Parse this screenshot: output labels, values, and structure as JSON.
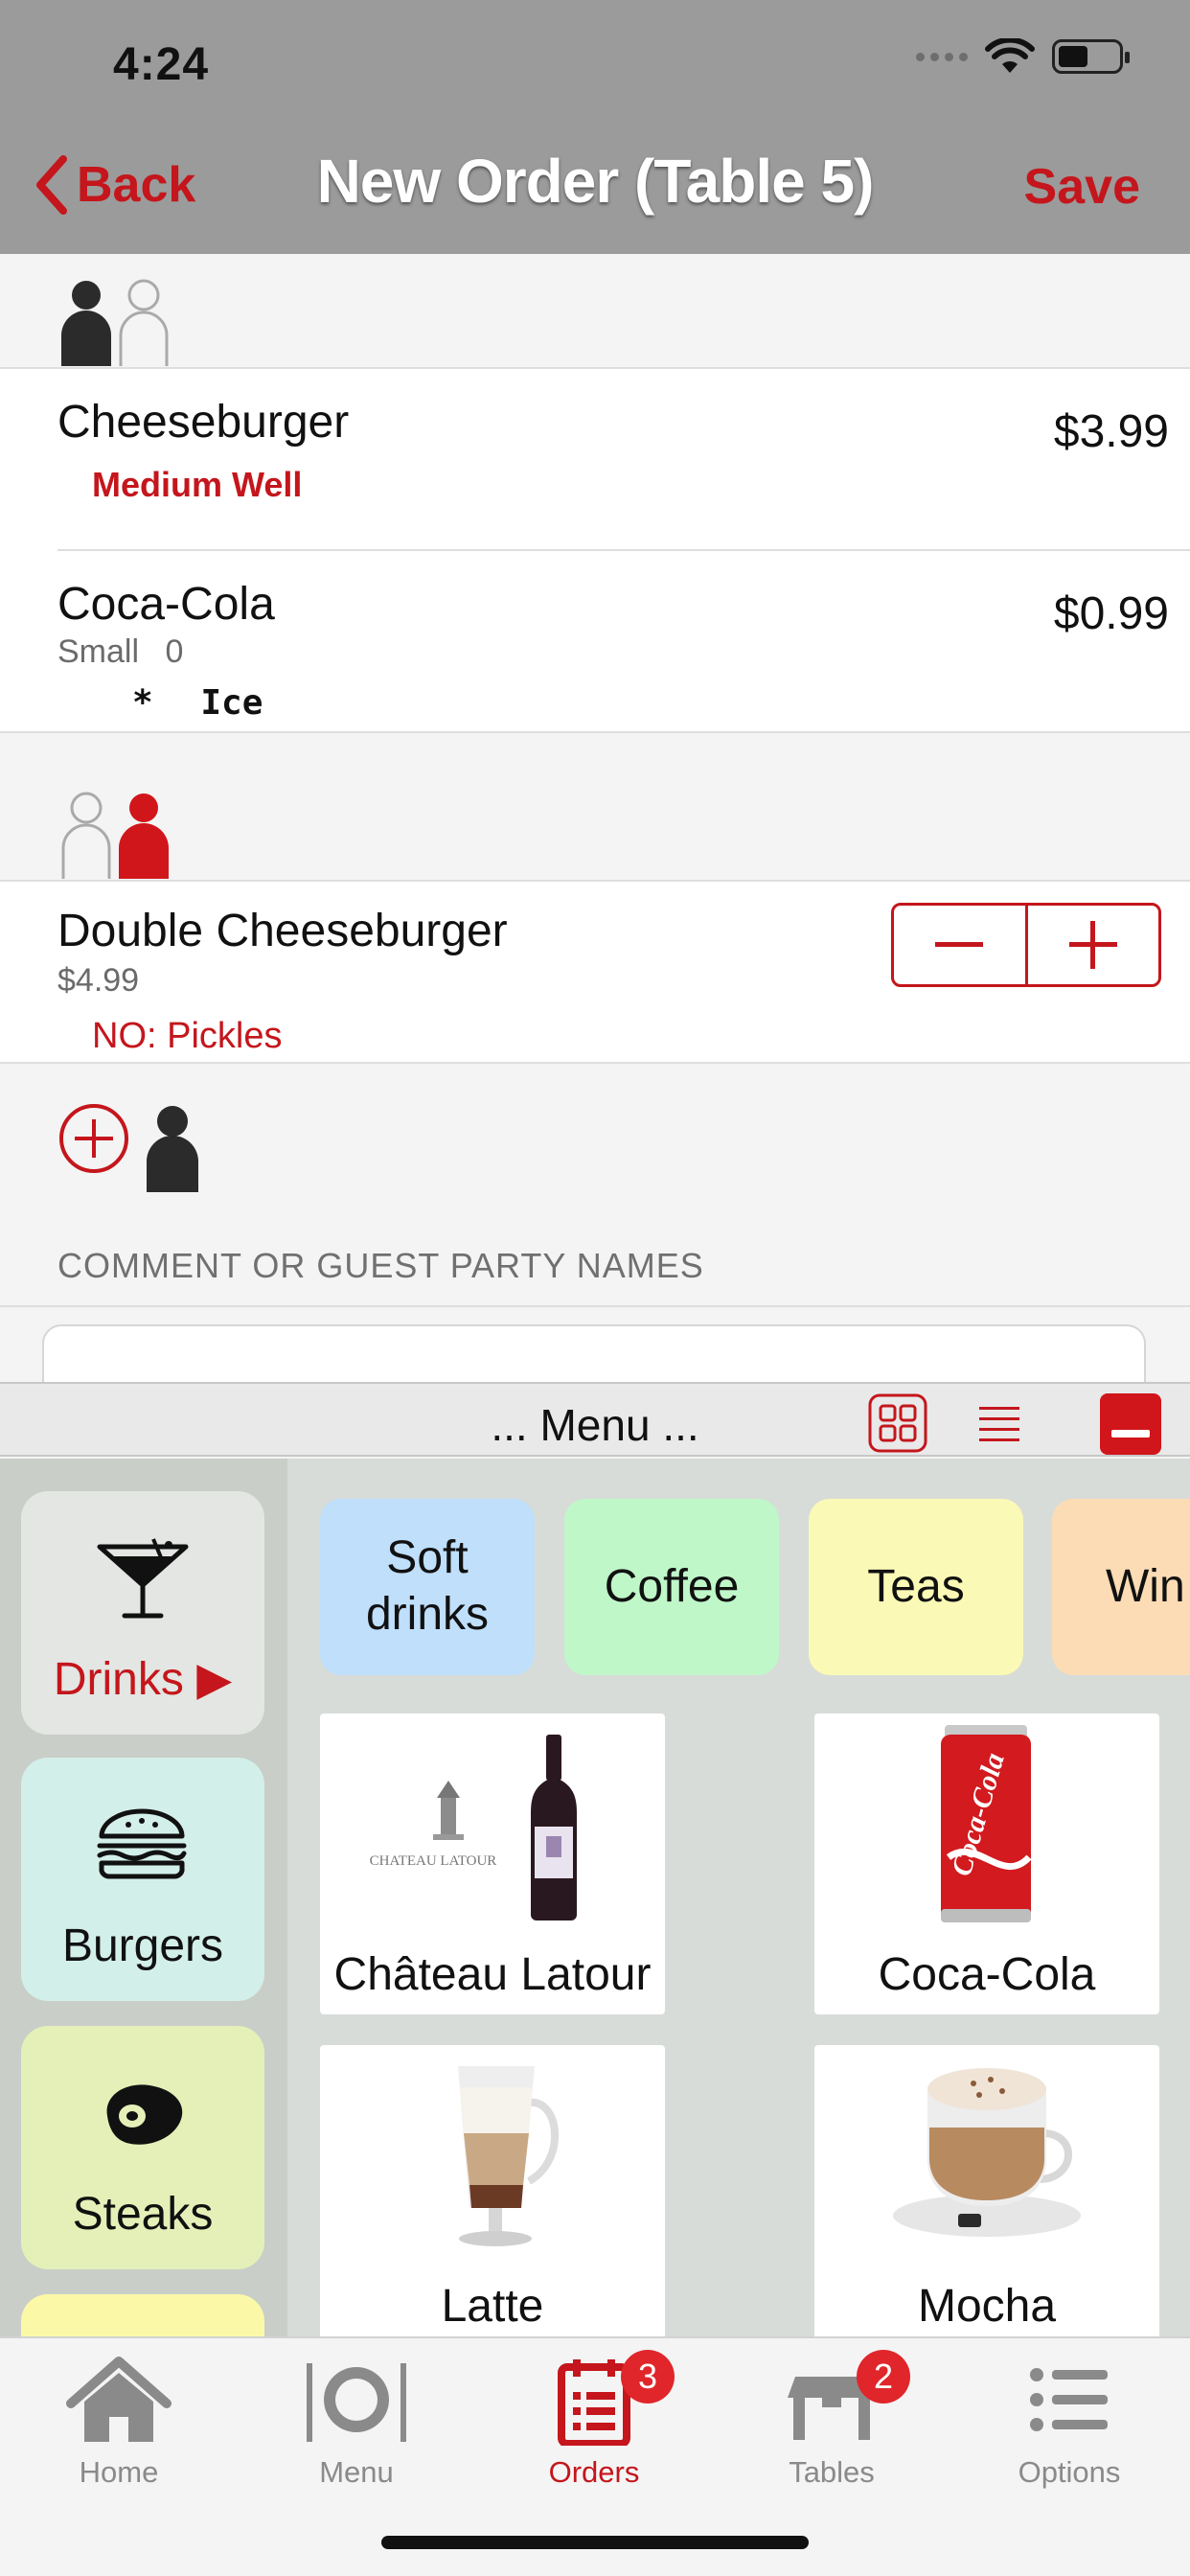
{
  "status_bar": {
    "time": "4:24"
  },
  "nav": {
    "back_label": "Back",
    "title": "New Order (Table 5)",
    "save_label": "Save"
  },
  "order": {
    "seat1": {
      "items": [
        {
          "name": "Cheeseburger",
          "price": "$3.99",
          "modifier": "Medium Well"
        },
        {
          "name": "Coca-Cola",
          "price": "$0.99",
          "size": "Small",
          "qty": "0",
          "note_marker": "*",
          "note": "Ice"
        }
      ]
    },
    "seat2": {
      "items": [
        {
          "name": "Double Cheeseburger",
          "unit_price": "$4.99",
          "modifier": "NO: Pickles"
        }
      ]
    }
  },
  "comment": {
    "label": "COMMENT OR GUEST PARTY NAMES",
    "value": ""
  },
  "menu": {
    "title": "... Menu ...",
    "categories": [
      {
        "label": "Drinks ▶",
        "icon": "cocktail-icon",
        "color": "#e3e6e3",
        "selected": true
      },
      {
        "label": "Burgers",
        "icon": "burger-icon",
        "color": "#d3efe9"
      },
      {
        "label": "Steaks",
        "icon": "steak-icon",
        "color": "#e4f0b8"
      },
      {
        "label": "",
        "color": "#fbf9a8"
      }
    ],
    "subcategories": [
      {
        "label": "Soft drinks",
        "color": "#bfdffb"
      },
      {
        "label": "Coffee",
        "color": "#bff7c9"
      },
      {
        "label": "Teas",
        "color": "#fbf9b6"
      },
      {
        "label": "Win",
        "color": "#fbdcb4"
      }
    ],
    "products": [
      {
        "name": "Château Latour",
        "image": "wine-bottle",
        "brand_text": "CHATEAU LATOUR"
      },
      {
        "name": "Coca-Cola",
        "image": "coca-cola-can",
        "brand_text": "Coca-Cola"
      },
      {
        "name": "Latte",
        "image": "latte-glass"
      },
      {
        "name": "Mocha",
        "image": "mocha-cup"
      }
    ]
  },
  "tabs": [
    {
      "label": "Home",
      "icon": "home-icon"
    },
    {
      "label": "Menu",
      "icon": "plate-cutlery-icon"
    },
    {
      "label": "Orders",
      "icon": "orders-icon",
      "badge": "3",
      "active": true
    },
    {
      "label": "Tables",
      "icon": "table-icon",
      "badge": "2"
    },
    {
      "label": "Options",
      "icon": "list-icon"
    }
  ],
  "colors": {
    "accent": "#c4161c",
    "header": "#9b9b9b",
    "badge": "#e0262b"
  }
}
